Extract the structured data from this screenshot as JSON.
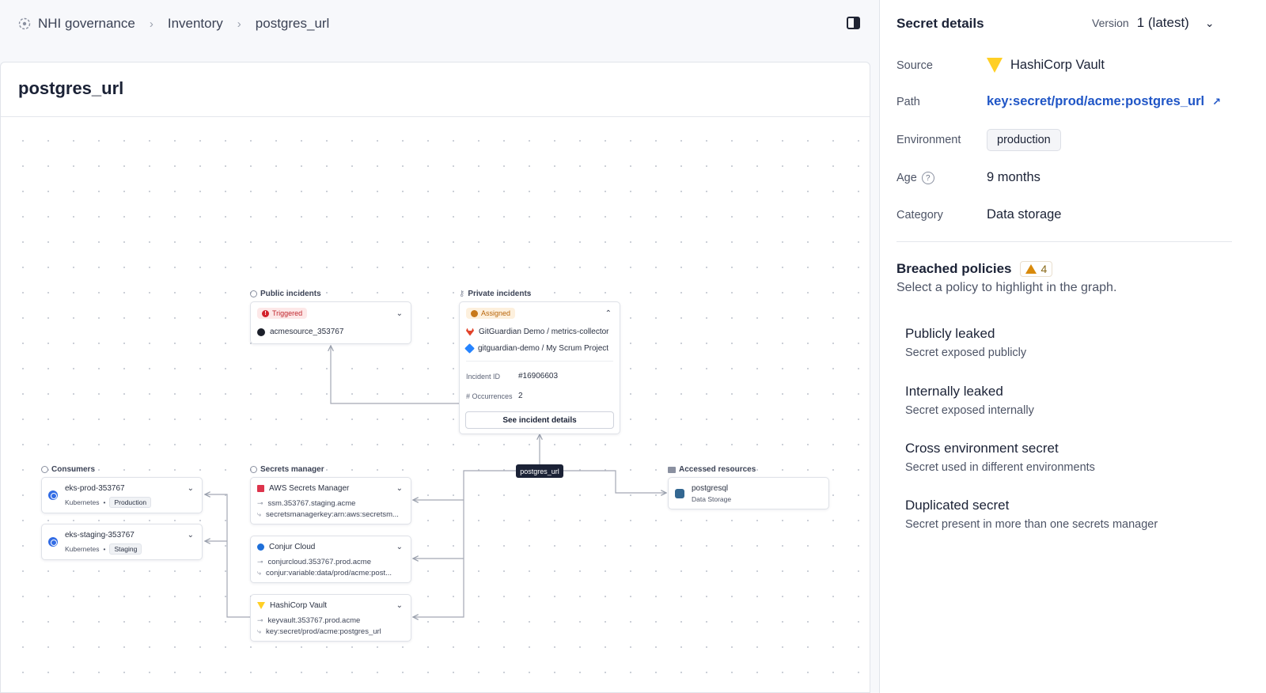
{
  "breadcrumb": {
    "icon": "nhi-governance-icon",
    "items": [
      "NHI governance",
      "Inventory",
      "postgres_url"
    ]
  },
  "page": {
    "title": "postgres_url"
  },
  "graph": {
    "center_node": "postgres_url",
    "public_incidents": {
      "label": "Public incidents",
      "status": "Triggered",
      "source": "acmesource_353767"
    },
    "private_incidents": {
      "label": "Private incidents",
      "status": "Assigned",
      "sources": [
        "GitGuardian Demo / metrics-collector",
        "gitguardian-demo / My Scrum Project"
      ],
      "incident_id_label": "Incident ID",
      "incident_id": "#16906603",
      "occurrences_label": "# Occurrences",
      "occurrences": "2",
      "button": "See incident details"
    },
    "consumers": {
      "label": "Consumers",
      "items": [
        {
          "name": "eks-prod-353767",
          "type": "Kubernetes",
          "env": "Production"
        },
        {
          "name": "eks-staging-353767",
          "type": "Kubernetes",
          "env": "Staging"
        }
      ]
    },
    "secrets_manager": {
      "label": "Secrets manager",
      "items": [
        {
          "name": "AWS Secrets Manager",
          "line1": "ssm.353767.staging.acme",
          "line2": "secretsmanagerkey:arn:aws:secretsm..."
        },
        {
          "name": "Conjur Cloud",
          "line1": "conjurcloud.353767.prod.acme",
          "line2": "conjur:variable:data/prod/acme:post..."
        },
        {
          "name": "HashiCorp Vault",
          "line1": "keyvault.353767.prod.acme",
          "line2": "key:secret/prod/acme:postgres_url"
        }
      ]
    },
    "accessed_resources": {
      "label": "Accessed resources",
      "items": [
        {
          "name": "postgresql",
          "type": "Data Storage"
        }
      ]
    }
  },
  "details": {
    "title": "Secret details",
    "version_label": "Version",
    "version_value": "1 (latest)",
    "source_label": "Source",
    "source_value": "HashiCorp Vault",
    "path_label": "Path",
    "path_value": "key:secret/prod/acme:postgres_url",
    "environment_label": "Environment",
    "environment_value": "production",
    "age_label": "Age",
    "age_value": "9 months",
    "category_label": "Category",
    "category_value": "Data storage"
  },
  "breached_policies": {
    "title": "Breached policies",
    "count": "4",
    "subtitle": "Select a policy to highlight in the graph.",
    "items": [
      {
        "name": "Publicly leaked",
        "desc": "Secret exposed publicly"
      },
      {
        "name": "Internally leaked",
        "desc": "Secret exposed internally"
      },
      {
        "name": "Cross environment secret",
        "desc": "Secret used in different environments"
      },
      {
        "name": "Duplicated secret",
        "desc": "Secret present in more than one secrets manager"
      }
    ]
  },
  "colors": {
    "link": "#1f55c6",
    "triggered": "#d3202a",
    "assigned": "#c7781a",
    "warning": "#d98a0b",
    "center_node": "#1b2236"
  }
}
